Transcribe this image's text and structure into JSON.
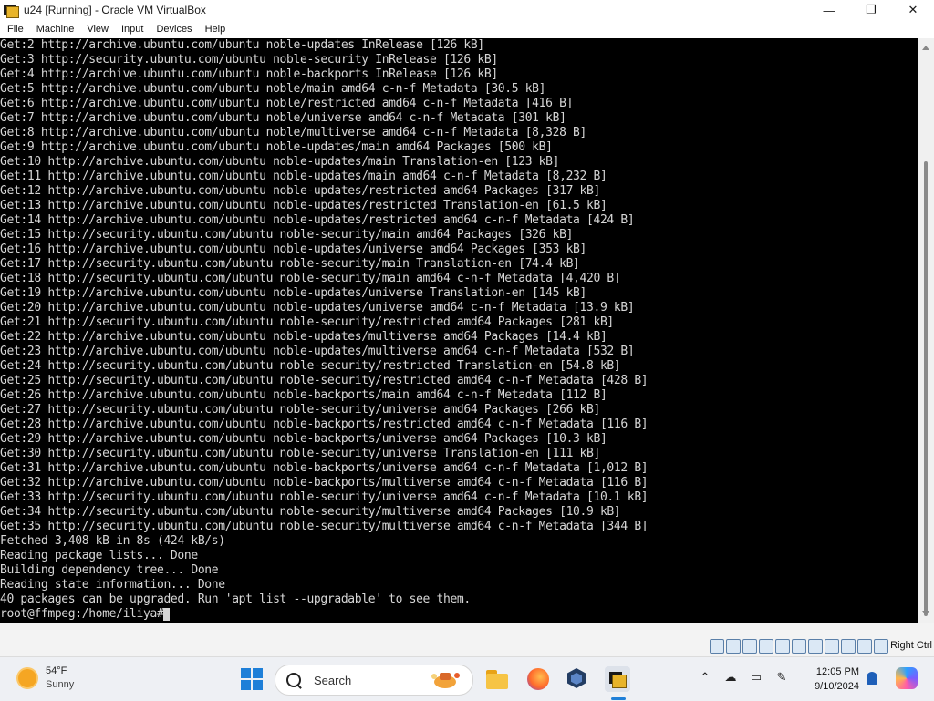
{
  "window": {
    "title": "u24 [Running] - Oracle VM VirtualBox",
    "minimize": "—",
    "maximize": "❐",
    "close": "✕"
  },
  "menu": [
    "File",
    "Machine",
    "View",
    "Input",
    "Devices",
    "Help"
  ],
  "terminal": {
    "lines": [
      "Get:2 http://archive.ubuntu.com/ubuntu noble-updates InRelease [126 kB]",
      "Get:3 http://security.ubuntu.com/ubuntu noble-security InRelease [126 kB]",
      "Get:4 http://archive.ubuntu.com/ubuntu noble-backports InRelease [126 kB]",
      "Get:5 http://archive.ubuntu.com/ubuntu noble/main amd64 c-n-f Metadata [30.5 kB]",
      "Get:6 http://archive.ubuntu.com/ubuntu noble/restricted amd64 c-n-f Metadata [416 B]",
      "Get:7 http://archive.ubuntu.com/ubuntu noble/universe amd64 c-n-f Metadata [301 kB]",
      "Get:8 http://archive.ubuntu.com/ubuntu noble/multiverse amd64 c-n-f Metadata [8,328 B]",
      "Get:9 http://archive.ubuntu.com/ubuntu noble-updates/main amd64 Packages [500 kB]",
      "Get:10 http://archive.ubuntu.com/ubuntu noble-updates/main Translation-en [123 kB]",
      "Get:11 http://archive.ubuntu.com/ubuntu noble-updates/main amd64 c-n-f Metadata [8,232 B]",
      "Get:12 http://archive.ubuntu.com/ubuntu noble-updates/restricted amd64 Packages [317 kB]",
      "Get:13 http://archive.ubuntu.com/ubuntu noble-updates/restricted Translation-en [61.5 kB]",
      "Get:14 http://archive.ubuntu.com/ubuntu noble-updates/restricted amd64 c-n-f Metadata [424 B]",
      "Get:15 http://security.ubuntu.com/ubuntu noble-security/main amd64 Packages [326 kB]",
      "Get:16 http://archive.ubuntu.com/ubuntu noble-updates/universe amd64 Packages [353 kB]",
      "Get:17 http://security.ubuntu.com/ubuntu noble-security/main Translation-en [74.4 kB]",
      "Get:18 http://security.ubuntu.com/ubuntu noble-security/main amd64 c-n-f Metadata [4,420 B]",
      "Get:19 http://archive.ubuntu.com/ubuntu noble-updates/universe Translation-en [145 kB]",
      "Get:20 http://archive.ubuntu.com/ubuntu noble-updates/universe amd64 c-n-f Metadata [13.9 kB]",
      "Get:21 http://security.ubuntu.com/ubuntu noble-security/restricted amd64 Packages [281 kB]",
      "Get:22 http://archive.ubuntu.com/ubuntu noble-updates/multiverse amd64 Packages [14.4 kB]",
      "Get:23 http://archive.ubuntu.com/ubuntu noble-updates/multiverse amd64 c-n-f Metadata [532 B]",
      "Get:24 http://security.ubuntu.com/ubuntu noble-security/restricted Translation-en [54.8 kB]",
      "Get:25 http://security.ubuntu.com/ubuntu noble-security/restricted amd64 c-n-f Metadata [428 B]",
      "Get:26 http://archive.ubuntu.com/ubuntu noble-backports/main amd64 c-n-f Metadata [112 B]",
      "Get:27 http://security.ubuntu.com/ubuntu noble-security/universe amd64 Packages [266 kB]",
      "Get:28 http://archive.ubuntu.com/ubuntu noble-backports/restricted amd64 c-n-f Metadata [116 B]",
      "Get:29 http://archive.ubuntu.com/ubuntu noble-backports/universe amd64 Packages [10.3 kB]",
      "Get:30 http://security.ubuntu.com/ubuntu noble-security/universe Translation-en [111 kB]",
      "Get:31 http://archive.ubuntu.com/ubuntu noble-backports/universe amd64 c-n-f Metadata [1,012 B]",
      "Get:32 http://archive.ubuntu.com/ubuntu noble-backports/multiverse amd64 c-n-f Metadata [116 B]",
      "Get:33 http://security.ubuntu.com/ubuntu noble-security/universe amd64 c-n-f Metadata [10.1 kB]",
      "Get:34 http://security.ubuntu.com/ubuntu noble-security/multiverse amd64 Packages [10.9 kB]",
      "Get:35 http://security.ubuntu.com/ubuntu noble-security/multiverse amd64 c-n-f Metadata [344 B]",
      "Fetched 3,408 kB in 8s (424 kB/s)",
      "Reading package lists... Done",
      "Building dependency tree... Done",
      "Reading state information... Done",
      "40 packages can be upgraded. Run 'apt list --upgradable' to see them."
    ],
    "prompt": "root@ffmpeg:/home/iliya#"
  },
  "statusbar": {
    "host_key": "Right Ctrl",
    "icons": [
      "hard-disk-icon",
      "optical-drive-icon",
      "audio-icon",
      "network-icon",
      "usb-icon",
      "shared-folder-icon",
      "display-icon",
      "recording-icon",
      "cpu-icon",
      "mouse-integration-icon",
      "keyboard-icon"
    ]
  },
  "taskbar": {
    "weather_temp": "54°F",
    "weather_cond": "Sunny",
    "search_placeholder": "Search",
    "time": "12:05 PM",
    "date": "9/10/2024",
    "accent": "#1e7fd8"
  }
}
